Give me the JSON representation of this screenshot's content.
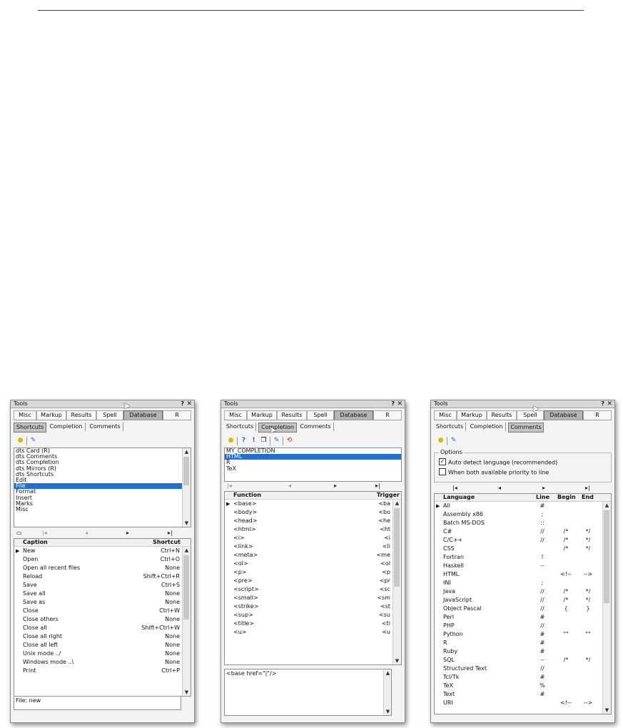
{
  "window_title": "Tools",
  "help_glyph": "?",
  "close_glyph": "✕",
  "main_tabs": [
    "Misc",
    "Markup",
    "Results",
    "Spell",
    "Database",
    "R"
  ],
  "sub_tabs": [
    "Shortcuts",
    "Completion",
    "Comments"
  ],
  "icons": {
    "bulb": "bulb-icon",
    "edit": "edit-icon",
    "help_context": "help-icon",
    "info": "info-icon",
    "copy": "copy-icon",
    "history": "history-icon",
    "new_doc": "new-document-icon"
  },
  "nav_glyphs": {
    "first": "|◂",
    "prev": "◂",
    "next": "▸",
    "last": "▸|"
  },
  "panel1": {
    "list": [
      "dts Card (R)",
      "dts Comments",
      "dts Completion",
      "dts Mirrors (R)",
      "dts Shortcuts",
      "Edit",
      "File",
      "Format",
      "Insert",
      "Marks",
      "Misc"
    ],
    "selected_index": 6,
    "grid_headers": {
      "caption": "Caption",
      "shortcut": "Shortcut"
    },
    "rows": [
      {
        "caption": "New",
        "shortcut": "Ctrl+N"
      },
      {
        "caption": "Open",
        "shortcut": "Ctrl+O"
      },
      {
        "caption": "Open all recent files",
        "shortcut": "None"
      },
      {
        "caption": "Reload",
        "shortcut": "Shift+Ctrl+R"
      },
      {
        "caption": "Save",
        "shortcut": "Ctrl+S"
      },
      {
        "caption": "Save all",
        "shortcut": "None"
      },
      {
        "caption": "Save as",
        "shortcut": "None"
      },
      {
        "caption": "Close",
        "shortcut": "Ctrl+W"
      },
      {
        "caption": "Close others",
        "shortcut": "None"
      },
      {
        "caption": "Close all",
        "shortcut": "Shift+Ctrl+W"
      },
      {
        "caption": "Close all right",
        "shortcut": "None"
      },
      {
        "caption": "Close all left",
        "shortcut": "None"
      },
      {
        "caption": "Unix mode ../",
        "shortcut": "None"
      },
      {
        "caption": "Windows mode ..\\",
        "shortcut": "None"
      },
      {
        "caption": "Print",
        "shortcut": "Ctrl+P"
      }
    ],
    "status": "File: new"
  },
  "panel2": {
    "list": [
      "MY_COMPLETION",
      "HTML",
      "R",
      "TeX"
    ],
    "selected_index": 1,
    "grid_headers": {
      "function": "Function",
      "trigger": "Trigger"
    },
    "rows": [
      {
        "function": "<base>",
        "trigger": "<ba"
      },
      {
        "function": "<body>",
        "trigger": "<bo"
      },
      {
        "function": "<head>",
        "trigger": "<he"
      },
      {
        "function": "<html>",
        "trigger": "<ht"
      },
      {
        "function": "<i>",
        "trigger": "<i"
      },
      {
        "function": "<link>",
        "trigger": "<li"
      },
      {
        "function": "<meta>",
        "trigger": "<me"
      },
      {
        "function": "<ol>",
        "trigger": "<ol"
      },
      {
        "function": "<p>",
        "trigger": "<p"
      },
      {
        "function": "<pre>",
        "trigger": "<pr"
      },
      {
        "function": "<script>",
        "trigger": "<sc"
      },
      {
        "function": "<small>",
        "trigger": "<sm"
      },
      {
        "function": "<strike>",
        "trigger": "<st"
      },
      {
        "function": "<sup>",
        "trigger": "<su"
      },
      {
        "function": "<title>",
        "trigger": "<ti"
      },
      {
        "function": "<u>",
        "trigger": "<u"
      }
    ],
    "memo": "<base href=\"|\"/>"
  },
  "panel3": {
    "options_label": "Options",
    "option1": "Auto detect language (recommended)",
    "option1_checked": true,
    "option2": "When both available priority to line",
    "option2_checked": false,
    "grid_headers": {
      "language": "Language",
      "line": "Line",
      "begin": "Begin",
      "end": "End"
    },
    "rows": [
      {
        "language": "All",
        "line": "#",
        "begin": "",
        "end": ""
      },
      {
        "language": "Assembly x86",
        "line": ";",
        "begin": "",
        "end": ""
      },
      {
        "language": "Batch MS-DOS",
        "line": "::",
        "begin": "",
        "end": ""
      },
      {
        "language": "C#",
        "line": "//",
        "begin": "/*",
        "end": "*/"
      },
      {
        "language": "C/C++",
        "line": "//",
        "begin": "/*",
        "end": "*/"
      },
      {
        "language": "CSS",
        "line": "",
        "begin": "/*",
        "end": "*/"
      },
      {
        "language": "Fortran",
        "line": "!",
        "begin": "",
        "end": ""
      },
      {
        "language": "Haskell",
        "line": "--",
        "begin": "",
        "end": ""
      },
      {
        "language": "HTML",
        "line": "",
        "begin": "<!--",
        "end": "-->"
      },
      {
        "language": "INI",
        "line": ";",
        "begin": "",
        "end": ""
      },
      {
        "language": "Java",
        "line": "//",
        "begin": "/*",
        "end": "*/"
      },
      {
        "language": "JavaScript",
        "line": "//",
        "begin": "/*",
        "end": "*/"
      },
      {
        "language": "Object Pascal",
        "line": "//",
        "begin": "{",
        "end": "}"
      },
      {
        "language": "Perl",
        "line": "#",
        "begin": "",
        "end": ""
      },
      {
        "language": "PHP",
        "line": "//",
        "begin": "",
        "end": ""
      },
      {
        "language": "Python",
        "line": "#",
        "begin": "\"\"",
        "end": "\"\""
      },
      {
        "language": "R",
        "line": "#",
        "begin": "",
        "end": ""
      },
      {
        "language": "Ruby",
        "line": "#",
        "begin": "",
        "end": ""
      },
      {
        "language": "SQL",
        "line": "--",
        "begin": "/*",
        "end": "*/"
      },
      {
        "language": "Structured Text",
        "line": "//",
        "begin": "",
        "end": ""
      },
      {
        "language": "Tcl/Tk",
        "line": "#",
        "begin": "",
        "end": ""
      },
      {
        "language": "TeX",
        "line": "%",
        "begin": "",
        "end": ""
      },
      {
        "language": "Text",
        "line": "#",
        "begin": "",
        "end": ""
      },
      {
        "language": "URI",
        "line": "",
        "begin": "<!--",
        "end": "-->"
      }
    ]
  }
}
